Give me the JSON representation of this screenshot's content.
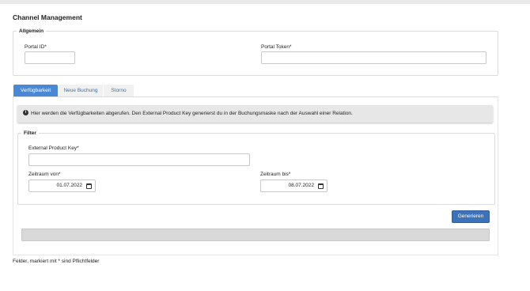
{
  "page_title": "Channel Management",
  "allgemein": {
    "legend": "Allgemein",
    "portal_id": {
      "label": "Portal ID*",
      "value": ""
    },
    "portal_token": {
      "label": "Portal Token*",
      "value": ""
    }
  },
  "tabs": [
    {
      "label": "Verfügbarkeit",
      "active": true
    },
    {
      "label": "Neue Buchung",
      "active": false
    },
    {
      "label": "Storno",
      "active": false
    }
  ],
  "info_message": "Hier werden die Verfügbarkeiten abgerufen. Den External Product Key generierst du in der Buchungsmaske nach der Auswahl einer Relation.",
  "filter": {
    "legend": "Filter",
    "external_product_key": {
      "label": "External Product Key*",
      "value": ""
    },
    "zeitraum_von": {
      "label": "Zeitraum von*",
      "value": "01.07.2022"
    },
    "zeitraum_bis": {
      "label": "Zeitraum bis*",
      "value": "08.07.2022"
    }
  },
  "generate_button": "Generieren",
  "footnote": "Felder, markiert mit * sind Pflichtfelder",
  "colors": {
    "accent": "#4a88d4",
    "button": "#3d72b8",
    "info_bg": "#e7e7e7",
    "progress_bg": "#d9d9d9"
  }
}
